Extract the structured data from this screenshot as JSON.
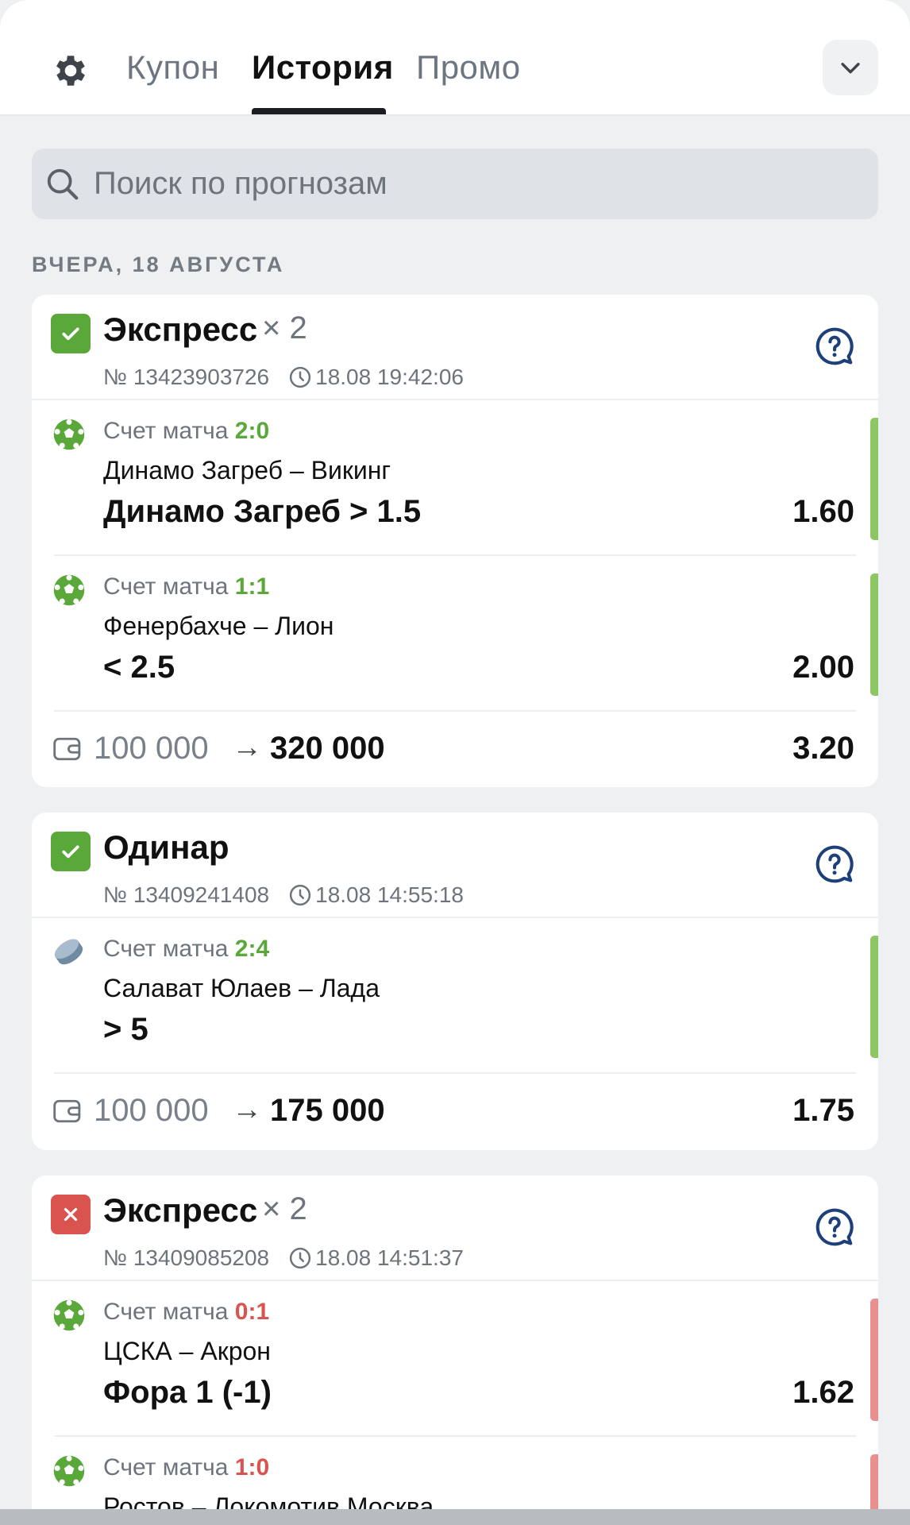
{
  "header": {
    "tabs": [
      {
        "label": "Купон"
      },
      {
        "label": "История"
      },
      {
        "label": "Промо"
      }
    ]
  },
  "search": {
    "placeholder": "Поиск по прогнозам",
    "value": ""
  },
  "date_header": "ВЧЕРА, 18 АВГУСТА",
  "bets": [
    {
      "status": "win",
      "title": "Экспресс",
      "multiplier": "× 2",
      "number": "№ 13423903726",
      "time": "18.08 19:42:06",
      "selections": [
        {
          "sport": "soccer-ball-icon",
          "score_label": "Счет матча",
          "score": "2:0",
          "teams": "Динамо Загреб – Викинг",
          "pick": "Динамо Загреб > 1.5",
          "odd": "1.60"
        },
        {
          "sport": "soccer-ball-icon",
          "score_label": "Счет матча",
          "score": "1:1",
          "teams": "Фенербахче – Лион",
          "pick": "< 2.5",
          "odd": "2.00"
        }
      ],
      "stake": "100 000",
      "arrow": "→",
      "payout": "320 000",
      "total_odd": "3.20"
    },
    {
      "status": "win",
      "title": "Одинар",
      "multiplier": "",
      "number": "№ 13409241408",
      "time": "18.08 14:55:18",
      "selections": [
        {
          "sport": "hockey-puck-icon",
          "score_label": "Счет матча",
          "score": "2:4",
          "teams": "Салават Юлаев – Лада",
          "pick": "> 5",
          "odd": ""
        }
      ],
      "stake": "100 000",
      "arrow": "→",
      "payout": "175 000",
      "total_odd": "1.75"
    },
    {
      "status": "loss",
      "title": "Экспресс",
      "multiplier": "× 2",
      "number": "№ 13409085208",
      "time": "18.08 14:51:37",
      "selections": [
        {
          "sport": "soccer-ball-icon",
          "score_label": "Счет матча",
          "score": "0:1",
          "teams": "ЦСКА – Акрон",
          "pick": "Фора 1 (-1)",
          "odd": "1.62"
        },
        {
          "sport": "soccer-ball-icon",
          "score_label": "Счет матча",
          "score": "1:0",
          "teams": "Ростов – Локомотив Москва",
          "pick": "",
          "odd": ""
        }
      ]
    }
  ],
  "colors": {
    "win": "#5aa73a",
    "loss": "#d9534f",
    "help_icon": "#1d3f7a"
  }
}
